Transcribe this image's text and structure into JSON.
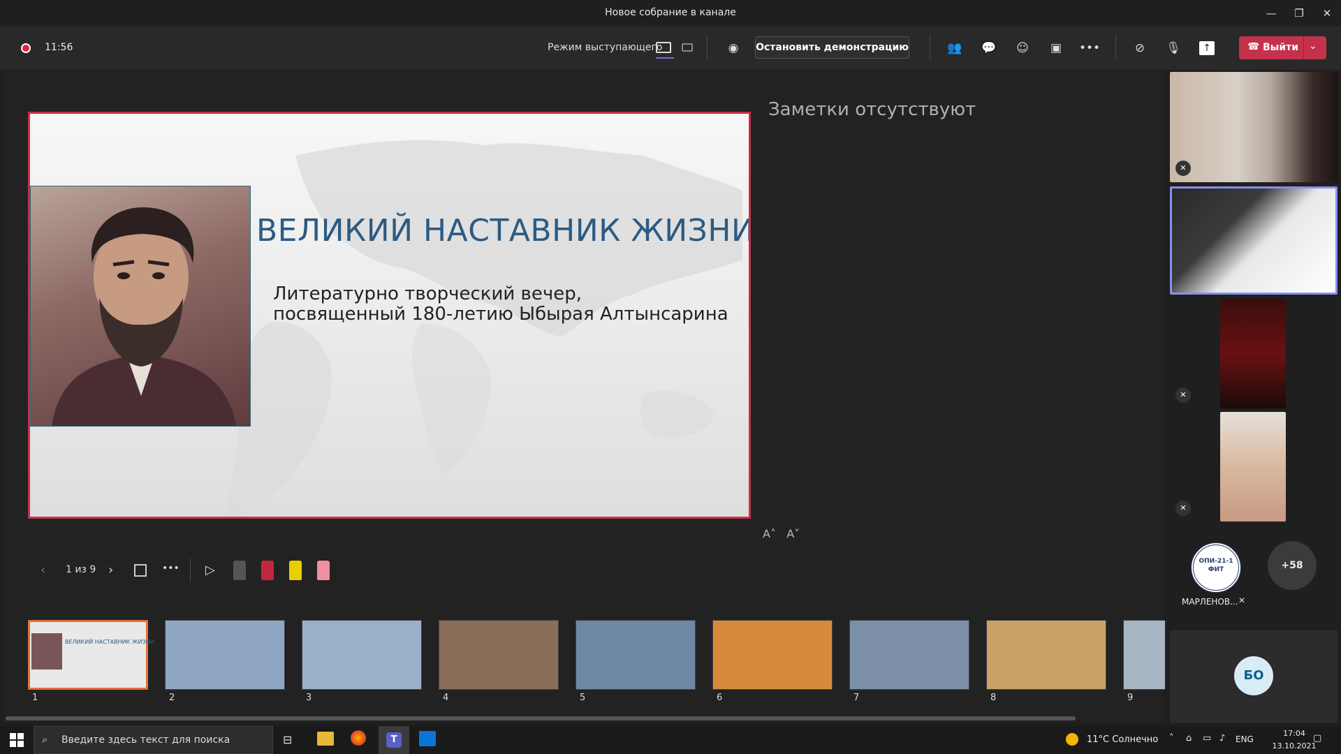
{
  "window": {
    "title": "Новое собрание в канале"
  },
  "toolbar": {
    "timer": "11:56",
    "presenter_mode_label": "Режим выступающего",
    "stop_share_label": "Остановить демонстрацию",
    "leave_label": "Выйти"
  },
  "slide": {
    "title": "ВЕЛИКИЙ НАСТАВНИК ЖИЗНИ",
    "subtitle_line1": "Литературно творческий вечер,",
    "subtitle_line2": "посвященный 180-летию Ыбырая Алтынсарина"
  },
  "notes": {
    "empty_text": "Заметки отсутствуют"
  },
  "nav": {
    "counter": "1 из 9"
  },
  "thumbnails": [
    {
      "num": "1",
      "label": "ВЕЛИКИЙ НАСТАВНИК ЖИЗНИ",
      "color": "#e9e9e9"
    },
    {
      "num": "2",
      "label": "",
      "color": "#8fa7c4"
    },
    {
      "num": "3",
      "label": "",
      "color": "#9ab0c8"
    },
    {
      "num": "4",
      "label": "",
      "color": "#8a6e5a"
    },
    {
      "num": "5",
      "label": "",
      "color": "#6f88a6"
    },
    {
      "num": "6",
      "label": "",
      "color": "#d8893c"
    },
    {
      "num": "7",
      "label": "",
      "color": "#7c8fa8"
    },
    {
      "num": "8",
      "label": "",
      "color": "#caa268"
    },
    {
      "num": "9",
      "label": "",
      "color": "#a7b5c2"
    }
  ],
  "participants": {
    "logo_text_top": "ОПИ-21-1",
    "logo_text_bottom": "ФИТ",
    "logo_label": "МАРЛЕНОВ...",
    "more_count": "+58",
    "avatar_initials": "БО"
  },
  "taskbar": {
    "search_placeholder": "Введите здесь текст для поиска",
    "weather": "11°C Солнечно",
    "lang": "ENG",
    "time": "17:04",
    "date": "13.10.2021"
  },
  "colors": {
    "accent": "#c4314b",
    "thumb_selected": "#e0713c",
    "slide_title": "#2c5a82"
  }
}
